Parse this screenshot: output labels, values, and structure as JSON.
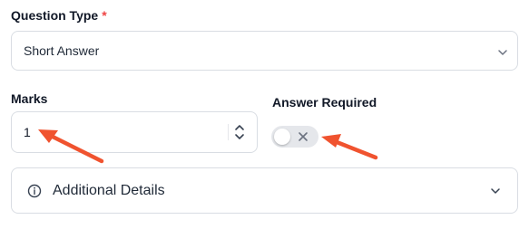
{
  "question_type": {
    "label": "Question Type",
    "required_marker": "*",
    "selected_value": "Short Answer",
    "icon": "chevron-down-icon"
  },
  "marks": {
    "label": "Marks",
    "value": "1",
    "icon": "stepper-icon"
  },
  "answer_required": {
    "label": "Answer Required",
    "enabled": false,
    "icon": "x-icon"
  },
  "additional_details": {
    "title": "Additional Details",
    "icon": "info-icon",
    "expanded": false
  },
  "colors": {
    "required_star": "#ef4444",
    "annotation_arrow": "#f0532f",
    "toggle_off": "#e5e7eb",
    "border": "#d9dde3"
  }
}
